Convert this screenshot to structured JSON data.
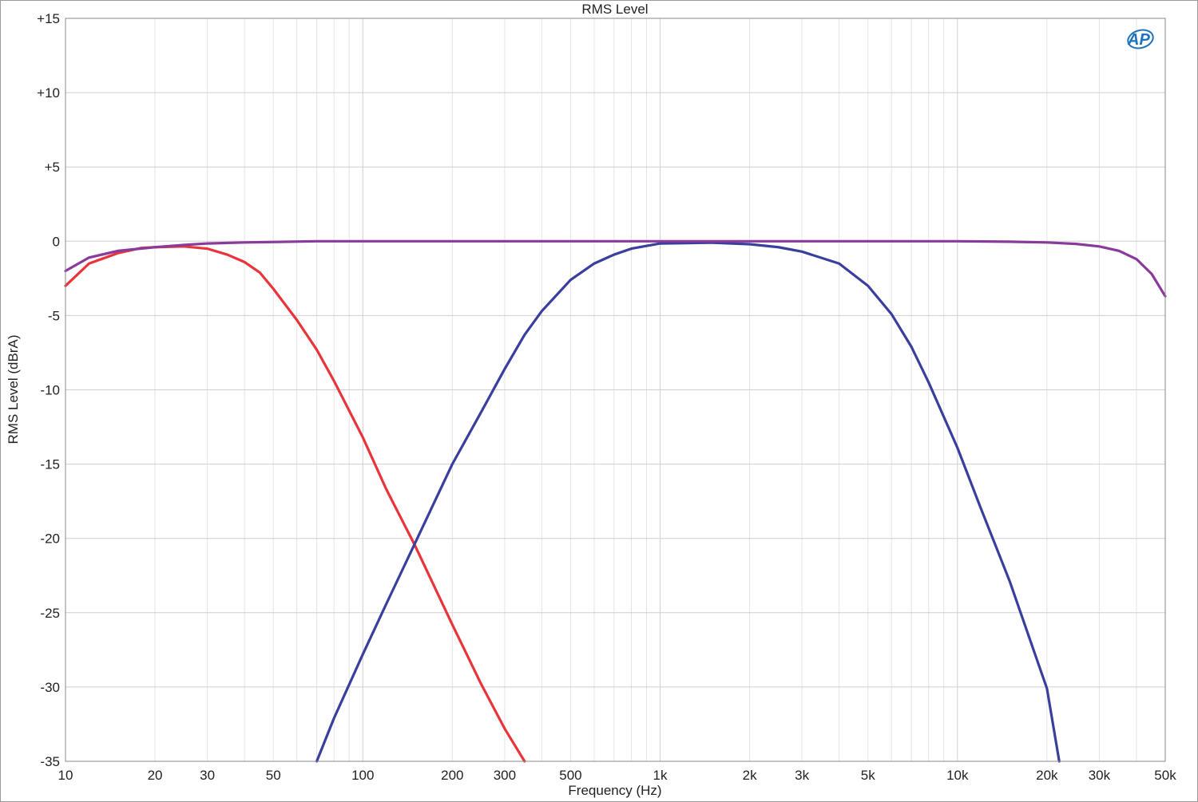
{
  "chart_data": {
    "type": "line",
    "title": "RMS Level",
    "xlabel": "Frequency (Hz)",
    "ylabel": "RMS Level (dBrA)",
    "x_scale": "log",
    "xlim": [
      10,
      50000
    ],
    "ylim": [
      -35,
      15
    ],
    "grid": true,
    "logo_text": "AP",
    "x_ticks": [
      {
        "value": 10,
        "label": "10"
      },
      {
        "value": 20,
        "label": "20"
      },
      {
        "value": 30,
        "label": "30"
      },
      {
        "value": 50,
        "label": "50"
      },
      {
        "value": 100,
        "label": "100"
      },
      {
        "value": 200,
        "label": "200"
      },
      {
        "value": 300,
        "label": "300"
      },
      {
        "value": 500,
        "label": "500"
      },
      {
        "value": 1000,
        "label": "1k"
      },
      {
        "value": 2000,
        "label": "2k"
      },
      {
        "value": 3000,
        "label": "3k"
      },
      {
        "value": 5000,
        "label": "5k"
      },
      {
        "value": 10000,
        "label": "10k"
      },
      {
        "value": 20000,
        "label": "20k"
      },
      {
        "value": 30000,
        "label": "30k"
      },
      {
        "value": 50000,
        "label": "50k"
      }
    ],
    "y_ticks": [
      {
        "value": 15,
        "label": "+15"
      },
      {
        "value": 10,
        "label": "+10"
      },
      {
        "value": 5,
        "label": "+5"
      },
      {
        "value": 0,
        "label": "0"
      },
      {
        "value": -5,
        "label": "-5"
      },
      {
        "value": -10,
        "label": "-10"
      },
      {
        "value": -15,
        "label": "-15"
      },
      {
        "value": -20,
        "label": "-20"
      },
      {
        "value": -25,
        "label": "-25"
      },
      {
        "value": -30,
        "label": "-30"
      },
      {
        "value": -35,
        "label": "-35"
      }
    ],
    "series": [
      {
        "color": "#e8343a",
        "x": [
          10,
          12,
          15,
          18,
          20,
          25,
          30,
          35,
          40,
          45,
          50,
          60,
          70,
          80,
          100,
          120,
          150,
          200,
          250,
          300,
          350
        ],
        "y": [
          -3.0,
          -1.5,
          -0.8,
          -0.45,
          -0.4,
          -0.35,
          -0.5,
          -0.9,
          -1.4,
          -2.1,
          -3.2,
          -5.3,
          -7.3,
          -9.4,
          -13.2,
          -16.7,
          -20.5,
          -25.8,
          -29.8,
          -32.8,
          -35.0
        ]
      },
      {
        "color": "#3a3f9e",
        "x": [
          70,
          80,
          100,
          120,
          150,
          200,
          250,
          300,
          350,
          400,
          500,
          600,
          700,
          800,
          1000,
          1500,
          2000,
          2500,
          3000,
          4000,
          5000,
          6000,
          7000,
          8000,
          10000,
          12000,
          15000,
          20000,
          22000
        ],
        "y": [
          -35.0,
          -32.1,
          -27.8,
          -24.4,
          -20.3,
          -15.0,
          -11.5,
          -8.6,
          -6.3,
          -4.7,
          -2.6,
          -1.5,
          -0.9,
          -0.5,
          -0.15,
          -0.1,
          -0.2,
          -0.4,
          -0.7,
          -1.5,
          -3.0,
          -4.9,
          -7.1,
          -9.5,
          -13.9,
          -18.0,
          -22.9,
          -30.1,
          -35.0
        ]
      },
      {
        "color": "#8a3a9a",
        "x": [
          10,
          12,
          15,
          20,
          25,
          30,
          40,
          50,
          70,
          100,
          200,
          500,
          1000,
          2000,
          5000,
          10000,
          15000,
          20000,
          25000,
          30000,
          35000,
          40000,
          45000,
          50000
        ],
        "y": [
          -2.0,
          -1.1,
          -0.65,
          -0.4,
          -0.25,
          -0.15,
          -0.08,
          -0.05,
          0,
          0,
          0,
          0,
          0,
          0,
          0,
          0,
          -0.03,
          -0.08,
          -0.18,
          -0.35,
          -0.65,
          -1.2,
          -2.2,
          -3.7
        ]
      }
    ]
  }
}
